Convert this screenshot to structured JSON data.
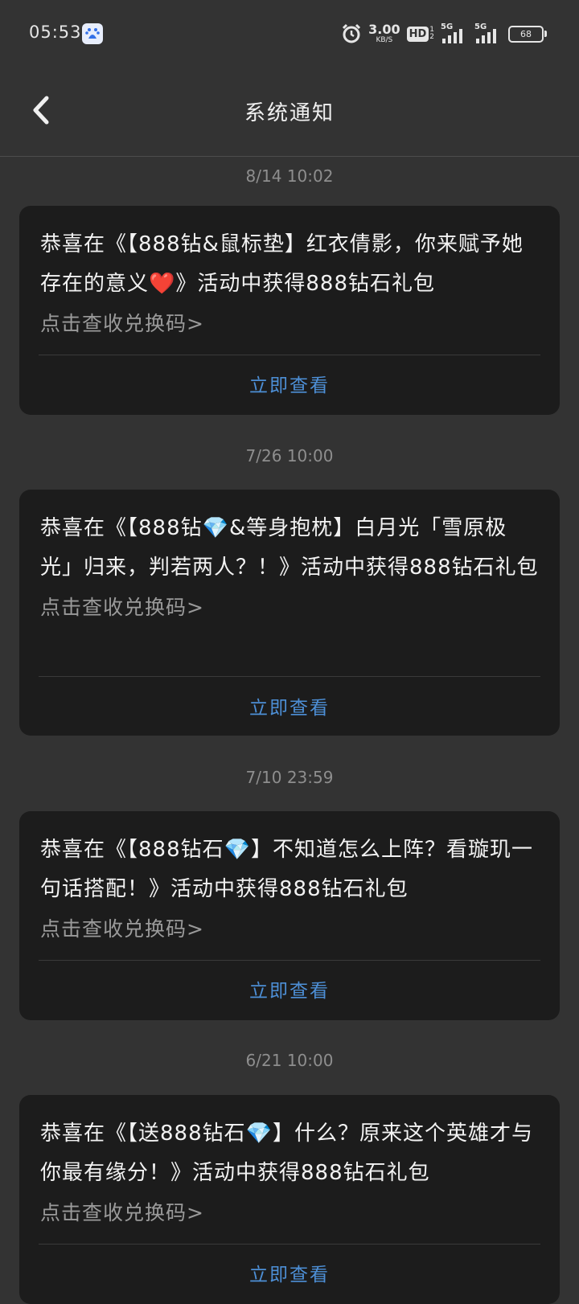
{
  "status_bar": {
    "time": "05:53",
    "net_speed_value": "3.00",
    "net_speed_unit": "KB/S",
    "hd_label": "HD",
    "hd_sim_top": "1",
    "hd_sim_bottom": "2",
    "signal1_label": "5G",
    "signal2_label": "5G",
    "battery_level": "68"
  },
  "header": {
    "title": "系统通知"
  },
  "notifications": [
    {
      "date": "8/14  10:02",
      "text": "恭喜在《【888钻&鼠标垫】红衣倩影，你来赋予她存在的意义❤️》活动中获得888钻石礼包",
      "link": "点击查收兑换码>",
      "action": "立即查看"
    },
    {
      "date": "7/26  10:00",
      "text": "恭喜在《【888钻💎&等身抱枕】白月光「雪原极光」归来，判若两人？！》活动中获得888钻石礼包",
      "link": "点击查收兑换码>",
      "action": "立即查看"
    },
    {
      "date": "7/10  23:59",
      "text": "恭喜在《【888钻石💎】不知道怎么上阵？看璇玑一句话搭配！》活动中获得888钻石礼包",
      "link": "点击查收兑换码>",
      "action": "立即查看"
    },
    {
      "date": "6/21  10:00",
      "text": "恭喜在《【送888钻石💎】什么？原来这个英雄才与你最有缘分！》活动中获得888钻石礼包",
      "link": "点击查收兑换码>",
      "action": "立即查看"
    }
  ]
}
